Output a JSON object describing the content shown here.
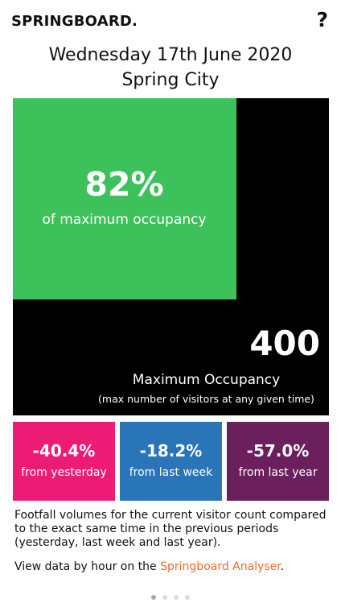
{
  "header": {
    "brand": "SPRINGBOARD.",
    "help_label": "?"
  },
  "date_line": "Wednesday 17th June 2020",
  "location": "Spring City",
  "occupancy": {
    "percent_value": 82,
    "percent_label": "82%",
    "percent_caption": "of maximum occupancy",
    "max_value": "400",
    "max_caption": "Maximum Occupancy",
    "max_subcaption": "(max number of visitors at any given time)"
  },
  "comparisons": [
    {
      "value": "-40.4%",
      "label": "from yesterday",
      "color": "#ec1b74"
    },
    {
      "value": "-18.2%",
      "label": "from last week",
      "color": "#2a74b8"
    },
    {
      "value": "-57.0%",
      "label": "from last year",
      "color": "#6b1f5c"
    }
  ],
  "footnote": "Footfall volumes for the current visitor count compared to the exact same time in the previous periods (yesterday, last week and last year).",
  "analyser": {
    "prefix": "View data by hour on the ",
    "link_text": "Springboard Analyser",
    "suffix": "."
  },
  "pager": {
    "page_count": 4,
    "active_index": 0
  },
  "colors": {
    "occupancy_fill": "#3dc15b",
    "panel_background": "#000000",
    "link": "#f26a2e",
    "dot_active": "#a9a9a9",
    "dot_inactive": "#dcdcdc"
  }
}
